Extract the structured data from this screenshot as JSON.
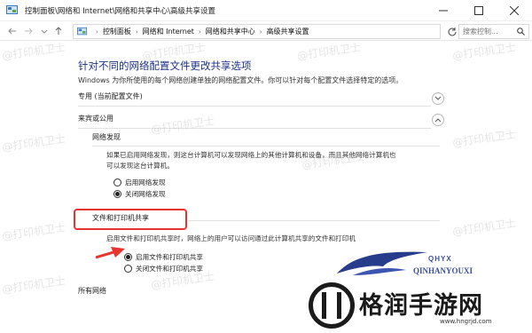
{
  "window": {
    "title": "控制面板\\网络和 Internet\\网络和共享中心\\高级共享设置"
  },
  "address": {
    "crumbs": [
      "控制面板",
      "网络和 Internet",
      "网络和共享中心",
      "高级共享设置"
    ],
    "search_placeholder": "搜索控制..."
  },
  "main": {
    "heading": "针对不同的网络配置文件更改共享选项",
    "description": "Windows 为你所使用的每个网络创建单独的网络配置文件。你可以针对每个配置文件选择特定的选项。",
    "profiles": [
      {
        "label": "专用 (当前配置文件)",
        "expanded": false
      },
      {
        "label": "来宾或公用",
        "expanded": true
      },
      {
        "label": "所有网络",
        "expanded": false
      }
    ],
    "network_discovery": {
      "title": "网络发现",
      "text_line1": "如果已启用网络发现，则这台计算机可以发现网络上的其他计算机和设备，而且其他网络计算机也",
      "text_line2": "可以发现这台计算机。",
      "options": [
        {
          "label": "启用网络发现",
          "selected": false
        },
        {
          "label": "关闭网络发现",
          "selected": true
        }
      ]
    },
    "file_sharing": {
      "title": "文件和打印机共享",
      "text": "启用文件和打印机共享时，网络上的用户可以访问通过此计算机共享的文件和打印机",
      "options": [
        {
          "label": "启用文件和打印机共享",
          "selected": true
        },
        {
          "label": "关闭文件和打印机共享",
          "selected": false
        }
      ]
    }
  },
  "watermark": "@打印机卫士",
  "logo": {
    "small": "QHYX",
    "pinyin": "QINHANYOUXI",
    "name": "格润手游网",
    "url": "www.hngrjd.com"
  },
  "colors": {
    "heading": "#1e3287",
    "highlight_box": "#e8332f",
    "arrow": "#e8332f"
  }
}
